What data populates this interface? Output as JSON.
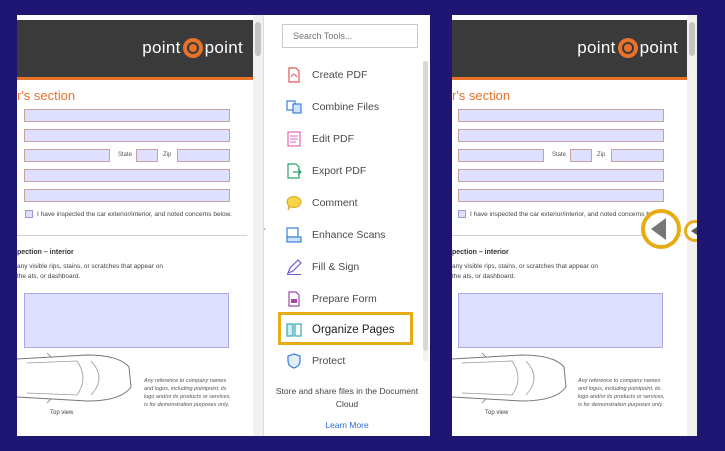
{
  "document": {
    "logo_left": "point",
    "logo_right": "point",
    "section_title": "r's section",
    "state_label": "State",
    "zip_label": "Zip",
    "inspected_text": "I have inspected the car exterior/interior, and noted concerns below.",
    "inspection_title": "pection – interior",
    "inspection_text": "any visible rips, stains, or scratches that appear on the ats, or dashboard.",
    "disclaimer": "Any reference to company names and logos, including pointpoint, its logo and/or its products or services, is for demonstration purposes only.",
    "top_view_label": "Top view"
  },
  "tools_pane": {
    "search_placeholder": "Search Tools...",
    "items": [
      {
        "label": "Create PDF",
        "icon": "create-pdf-icon"
      },
      {
        "label": "Combine Files",
        "icon": "combine-files-icon"
      },
      {
        "label": "Edit PDF",
        "icon": "edit-pdf-icon"
      },
      {
        "label": "Export PDF",
        "icon": "export-pdf-icon"
      },
      {
        "label": "Comment",
        "icon": "comment-icon"
      },
      {
        "label": "Enhance Scans",
        "icon": "enhance-scans-icon"
      },
      {
        "label": "Fill & Sign",
        "icon": "fill-sign-icon"
      },
      {
        "label": "Prepare Form",
        "icon": "prepare-form-icon"
      },
      {
        "label": "Organize Pages",
        "icon": "organize-pages-icon"
      },
      {
        "label": "Protect",
        "icon": "protect-icon"
      }
    ],
    "footer_text": "Store and share files in the Document Cloud",
    "learn_more": "Learn More"
  },
  "colors": {
    "background": "#1e1672",
    "accent_orange": "#e8722a",
    "highlight_yellow": "#e6ac16",
    "field_fill": "#dfe0ff",
    "link_blue": "#2a6cd6"
  }
}
